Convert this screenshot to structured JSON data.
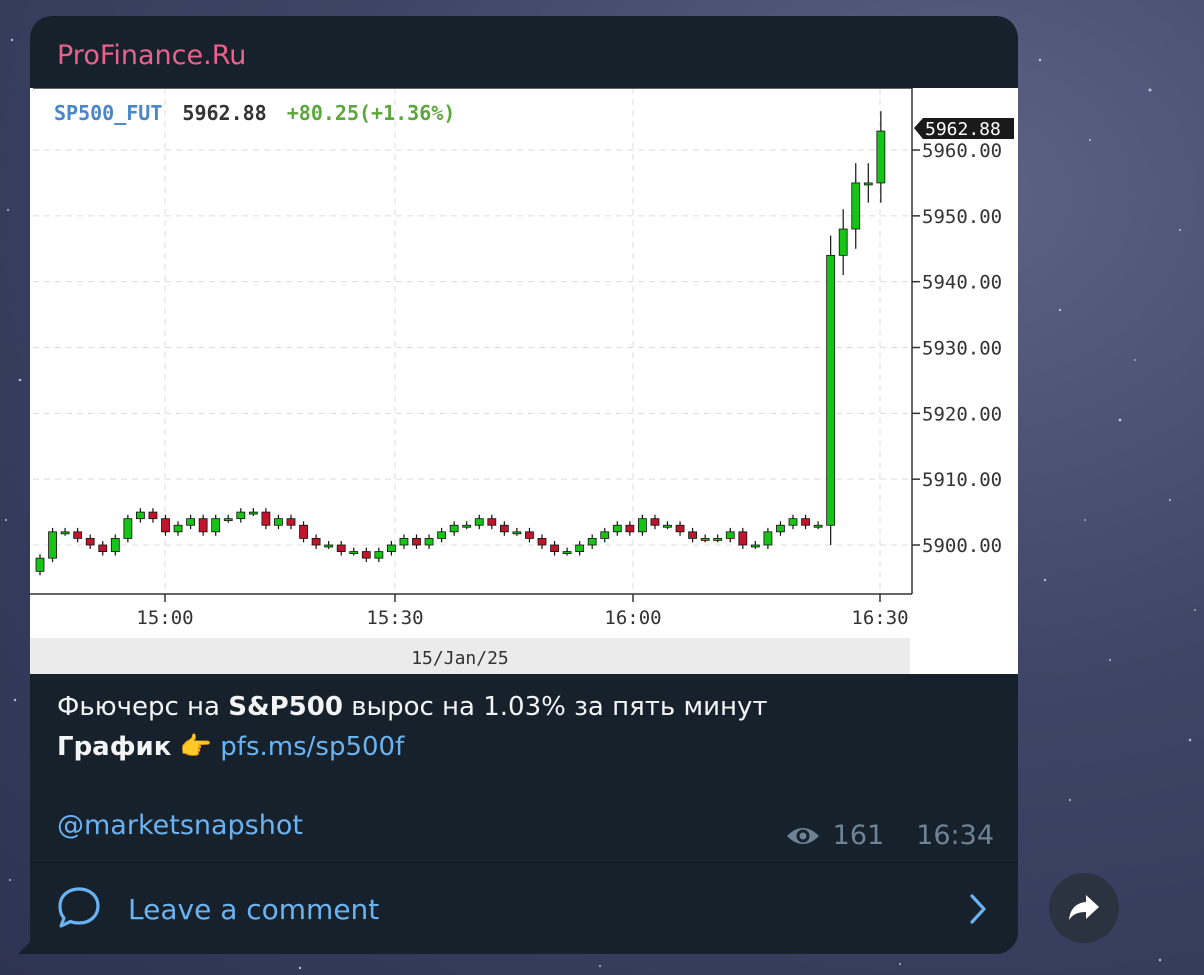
{
  "channel": {
    "name": "ProFinance.Ru"
  },
  "chart": {
    "symbol": "SP500_FUT",
    "price": "5962.88",
    "change": "+80.25(+1.36%)",
    "last_tag": "5962.88",
    "date_label": "15/Jan/25",
    "colors": {
      "up": "#16c416",
      "down": "#c0152d",
      "symbol": "#4a86c8",
      "change": "#5aa83a"
    }
  },
  "chart_data": {
    "type": "candlestick",
    "x_ticks": [
      "15:00",
      "15:30",
      "16:00",
      "16:30"
    ],
    "y_ticks": [
      "5900.00",
      "5910.00",
      "5920.00",
      "5930.00",
      "5940.00",
      "5950.00",
      "5960.00"
    ],
    "ylim": [
      5897,
      5965
    ],
    "grid": true,
    "closes": [
      5898,
      5902,
      5902,
      5901,
      5900,
      5899,
      5901,
      5904,
      5905,
      5904,
      5902,
      5903,
      5904,
      5902,
      5904,
      5904,
      5905,
      5905,
      5903,
      5904,
      5903,
      5901,
      5900,
      5900,
      5899,
      5899,
      5898,
      5899,
      5900,
      5901,
      5900,
      5901,
      5902,
      5903,
      5903,
      5904,
      5903,
      5902,
      5902,
      5901,
      5900,
      5899,
      5899,
      5900,
      5901,
      5902,
      5903,
      5902,
      5904,
      5903,
      5903,
      5902,
      5901,
      5901,
      5901,
      5902,
      5900,
      5900,
      5902,
      5903,
      5904,
      5903,
      5903,
      5944,
      5948,
      5955,
      5955,
      5962.88
    ]
  },
  "message": {
    "line1_prefix": "Фьючерс на ",
    "line1_bold": "S&P500",
    "line1_suffix": " вырос на 1.03% за пять минут",
    "line2_bold": "График",
    "line2_emoji": "👉",
    "line2_link": "pfs.ms/sp500f",
    "handle": "@marketsnapshot"
  },
  "meta": {
    "views": "161",
    "time": "16:34"
  },
  "comments": {
    "label": "Leave a comment"
  }
}
